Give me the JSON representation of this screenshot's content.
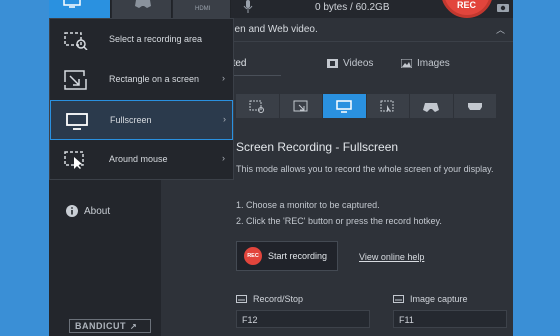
{
  "top_bar": {
    "storage_label": "0 bytes / 60.2GB",
    "hdmi_tab_label": "HDMI",
    "rec_button_label": "REC"
  },
  "header": {
    "text": "een and Web video.",
    "collapse_icon": "chevron-up-icon"
  },
  "sub_tabs": [
    {
      "label": "Get started",
      "icon": "home-icon",
      "active": true
    },
    {
      "label": "Videos",
      "icon": "film-icon"
    },
    {
      "label": "Images",
      "icon": "image-icon"
    }
  ],
  "mode_bar": [
    {
      "icon": "select-area-icon"
    },
    {
      "icon": "rectangle-icon"
    },
    {
      "icon": "fullscreen-monitor-icon",
      "active": true
    },
    {
      "icon": "around-mouse-icon"
    },
    {
      "icon": "gamepad-icon"
    },
    {
      "icon": "hdmi-icon"
    }
  ],
  "section": {
    "title": "Screen Recording - Fullscreen",
    "description": "This mode allows you to record the whole screen of your display.",
    "steps": [
      "1. Choose a monitor to be captured.",
      "2. Click the 'REC' button or press the record hotkey."
    ],
    "start_button_label": "Start recording",
    "start_button_badge": "REC",
    "help_link": "View online help"
  },
  "hotkeys": [
    {
      "label": "Record/Stop",
      "value": "F12"
    },
    {
      "label": "Image capture",
      "value": "F11"
    }
  ],
  "sidebar": {
    "about_label": "About",
    "brand": "BANDICUT",
    "brand_arrow": "↗"
  },
  "menu": {
    "items": [
      {
        "label": "Select a recording area",
        "icon": "select-area-icon",
        "has_submenu": false
      },
      {
        "label": "Rectangle on a screen",
        "icon": "rectangle-arrow-icon",
        "has_submenu": true
      },
      {
        "label": "Fullscreen",
        "icon": "monitor-icon",
        "has_submenu": true,
        "selected": true
      },
      {
        "label": "Around mouse",
        "icon": "around-mouse-icon",
        "has_submenu": true
      }
    ],
    "submenu_arrow": "›"
  },
  "colors": {
    "accent": "#2a91e0",
    "rec": "#e2453c",
    "background": "#3a8fd6",
    "panel": "#2e3239"
  }
}
